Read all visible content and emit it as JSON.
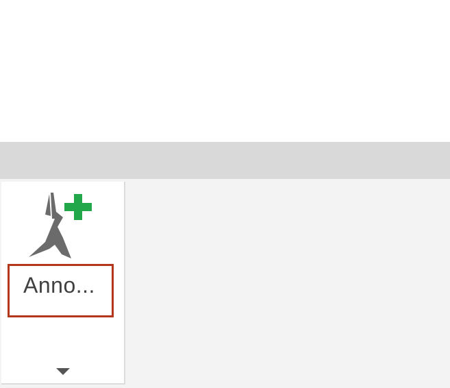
{
  "ribbon": {
    "tool": {
      "label": "Anno...",
      "icon": "add-annotation-icon",
      "dropdown_icon": "chevron-down-icon",
      "highlight_color": "#b5371b",
      "plus_color": "#22a84a",
      "figure_color": "#6b6b6b"
    }
  }
}
